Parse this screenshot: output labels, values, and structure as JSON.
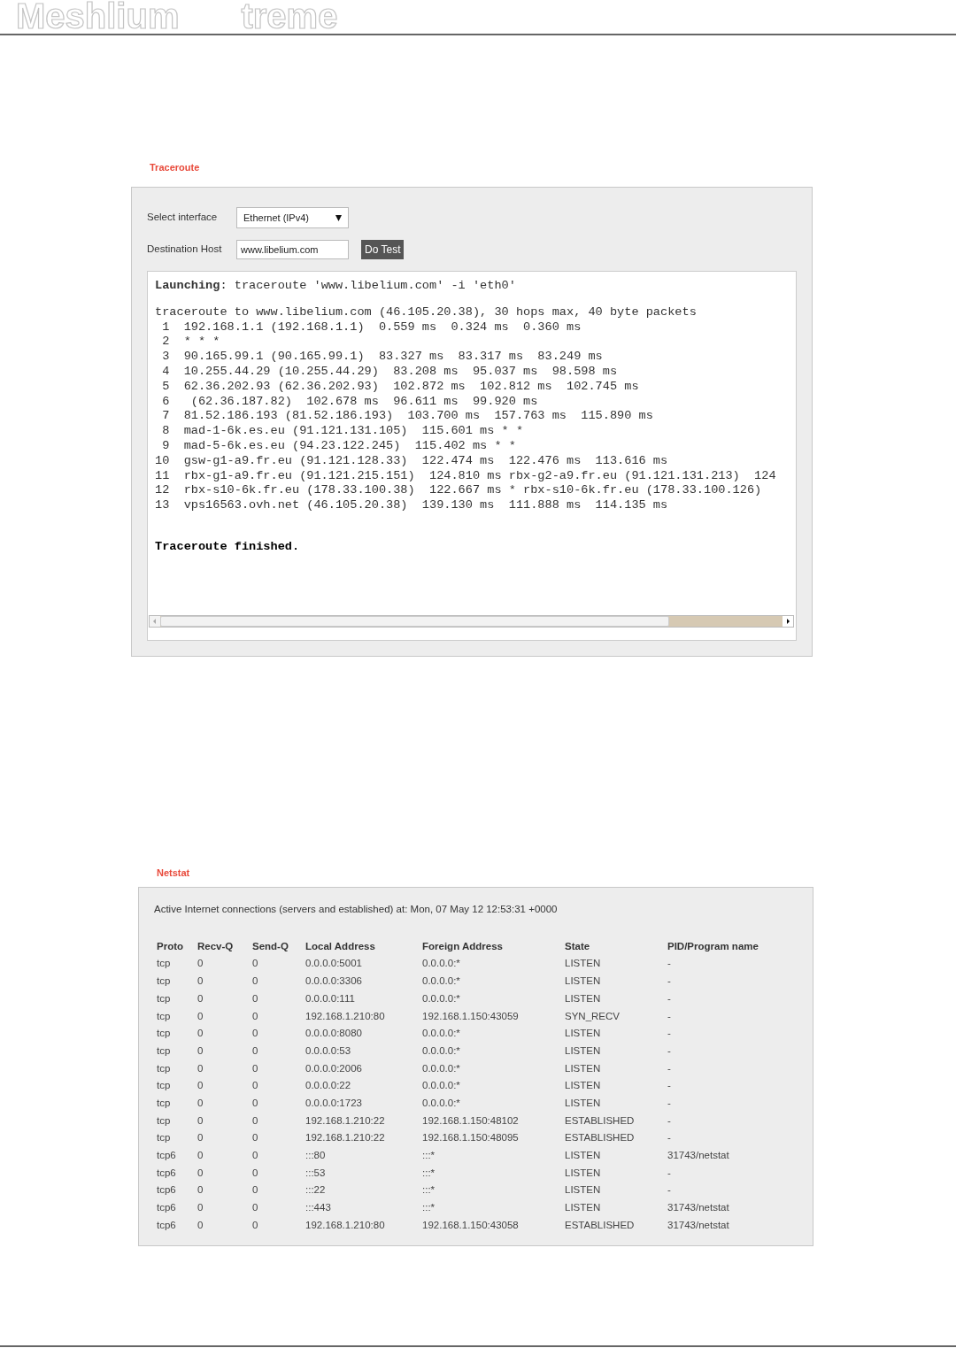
{
  "header": {
    "logo_left": "Meshlium",
    "logo_right": "treme"
  },
  "traceroute": {
    "title": "Traceroute",
    "interface": {
      "label": "Select interface",
      "value": "Ethernet (IPv4)"
    },
    "destination": {
      "label": "Destination Host",
      "value": "www.libelium.com"
    },
    "button": "Do Test",
    "launch": "**Launching**: traceroute 'www.libelium.com' -i 'eth0'",
    "output": [
      "traceroute to www.libelium.com (46.105.20.38), 30 hops max, 40 byte packets",
      " 1  192.168.1.1 (192.168.1.1)  0.559 ms  0.324 ms  0.360 ms",
      " 2  * * *",
      " 3  90.165.99.1 (90.165.99.1)  83.327 ms  83.317 ms  83.249 ms",
      " 4  10.255.44.29 (10.255.44.29)  83.208 ms  95.037 ms  98.598 ms",
      " 5  62.36.202.93 (62.36.202.93)  102.872 ms  102.812 ms  102.745 ms",
      " 6   (62.36.187.82)  102.678 ms  96.611 ms  99.920 ms",
      " 7  81.52.186.193 (81.52.186.193)  103.700 ms  157.763 ms  115.890 ms",
      " 8  mad-1-6k.es.eu (91.121.131.105)  115.601 ms * *",
      " 9  mad-5-6k.es.eu (94.23.122.245)  115.402 ms * *",
      "10  gsw-g1-a9.fr.eu (91.121.128.33)  122.474 ms  122.476 ms  113.616 ms",
      "11  rbx-g1-a9.fr.eu (91.121.215.151)  124.810 ms rbx-g2-a9.fr.eu (91.121.131.213)  124",
      "12  rbx-s10-6k.fr.eu (178.33.100.38)  122.667 ms * rbx-s10-6k.fr.eu (178.33.100.126)",
      "13  vps16563.ovh.net (46.105.20.38)  139.130 ms  111.888 ms  114.135 ms"
    ],
    "finished": "Traceroute finished."
  },
  "netstat": {
    "title": "Netstat",
    "summary": "Active Internet connections (servers and established) at: Mon, 07 May 12 12:53:31 +0000",
    "columns": [
      "Proto",
      "Recv-Q",
      "Send-Q",
      "Local Address",
      "Foreign Address",
      "State",
      "PID/Program name"
    ],
    "rows": [
      [
        "tcp",
        "0",
        "0",
        "0.0.0.0:5001",
        "0.0.0.0:*",
        "LISTEN",
        "-"
      ],
      [
        "tcp",
        "0",
        "0",
        "0.0.0.0:3306",
        "0.0.0.0:*",
        "LISTEN",
        "-"
      ],
      [
        "tcp",
        "0",
        "0",
        "0.0.0.0:111",
        "0.0.0.0:*",
        "LISTEN",
        "-"
      ],
      [
        "tcp",
        "0",
        "0",
        "192.168.1.210:80",
        "192.168.1.150:43059",
        "SYN_RECV",
        "-"
      ],
      [
        "tcp",
        "0",
        "0",
        "0.0.0.0:8080",
        "0.0.0.0:*",
        "LISTEN",
        "-"
      ],
      [
        "tcp",
        "0",
        "0",
        "0.0.0.0:53",
        "0.0.0.0:*",
        "LISTEN",
        "-"
      ],
      [
        "tcp",
        "0",
        "0",
        "0.0.0.0:2006",
        "0.0.0.0:*",
        "LISTEN",
        "-"
      ],
      [
        "tcp",
        "0",
        "0",
        "0.0.0.0:22",
        "0.0.0.0:*",
        "LISTEN",
        "-"
      ],
      [
        "tcp",
        "0",
        "0",
        "0.0.0.0:1723",
        "0.0.0.0:*",
        "LISTEN",
        "-"
      ],
      [
        "tcp",
        "0",
        "0",
        "192.168.1.210:22",
        "192.168.1.150:48102",
        "ESTABLISHED",
        "-"
      ],
      [
        "tcp",
        "0",
        "0",
        "192.168.1.210:22",
        "192.168.1.150:48095",
        "ESTABLISHED",
        "-"
      ],
      [
        "tcp6",
        "0",
        "0",
        ":::80",
        ":::*",
        "LISTEN",
        "31743/netstat"
      ],
      [
        "tcp6",
        "0",
        "0",
        ":::53",
        ":::*",
        "LISTEN",
        "-"
      ],
      [
        "tcp6",
        "0",
        "0",
        ":::22",
        ":::*",
        "LISTEN",
        "-"
      ],
      [
        "tcp6",
        "0",
        "0",
        ":::443",
        ":::*",
        "LISTEN",
        "31743/netstat"
      ],
      [
        "tcp6",
        "0",
        "0",
        "192.168.1.210:80",
        "192.168.1.150:43058",
        "ESTABLISHED",
        "31743/netstat"
      ]
    ]
  }
}
